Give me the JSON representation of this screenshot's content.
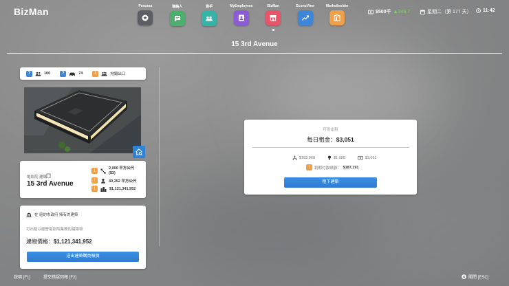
{
  "app": {
    "logo": "BizMan"
  },
  "nav": [
    {
      "label": "Persona",
      "icon": "persona-icon",
      "color": "#5b5f63"
    },
    {
      "label": "聯絡人",
      "icon": "chat-icon",
      "color": "#4caf6e"
    },
    {
      "label": "對手",
      "icon": "rivals-icon",
      "color": "#35b3a6"
    },
    {
      "label": "MyEmployees",
      "icon": "employees-icon",
      "color": "#8b5cd6"
    },
    {
      "label": "BizMan",
      "icon": "store-icon",
      "color": "#e8546a"
    },
    {
      "label": "EconoView",
      "icon": "chart-icon",
      "color": "#3d86d8"
    },
    {
      "label": "MarketInsider",
      "icon": "market-icon",
      "color": "#f0a04b"
    }
  ],
  "status": {
    "money": "$500千",
    "change": "▲349.7",
    "date": "星期二（第 177 天）",
    "time": "11:42",
    "change_color": "#7ed957"
  },
  "page": {
    "title": "15 3rd Avenue"
  },
  "stats": {
    "customers": "100",
    "traffic": "74",
    "area_label": "地鐵出口"
  },
  "info": {
    "district_label": "電影院 建築",
    "address": "15 3rd Avenue",
    "size": "2,000 平方公尺",
    "size_sub": "($3)",
    "population": "40,352 平方公尺",
    "value": "$1,121,341,952"
  },
  "purchase": {
    "notice": "在 紐約市政府 擁有的建築",
    "desc": "可出租以經營電影院業務的建築物",
    "price_label": "建物價格：",
    "price": "$1,121,341,952",
    "button": "送出建築購買報價"
  },
  "rent": {
    "header": "可供出租",
    "daily_label": "每日租金：",
    "daily_value": "$3,051",
    "cost1": "$183,060",
    "cost2": "$1,080",
    "cost3": "$3,051",
    "initial_label": "初期付款總額：",
    "initial_value": "$187,191",
    "button": "租下建築"
  },
  "footer": {
    "help": "說明 [F1]",
    "submit": "提交錯誤回報 [F2]",
    "close": "關閉 [ESC]"
  }
}
